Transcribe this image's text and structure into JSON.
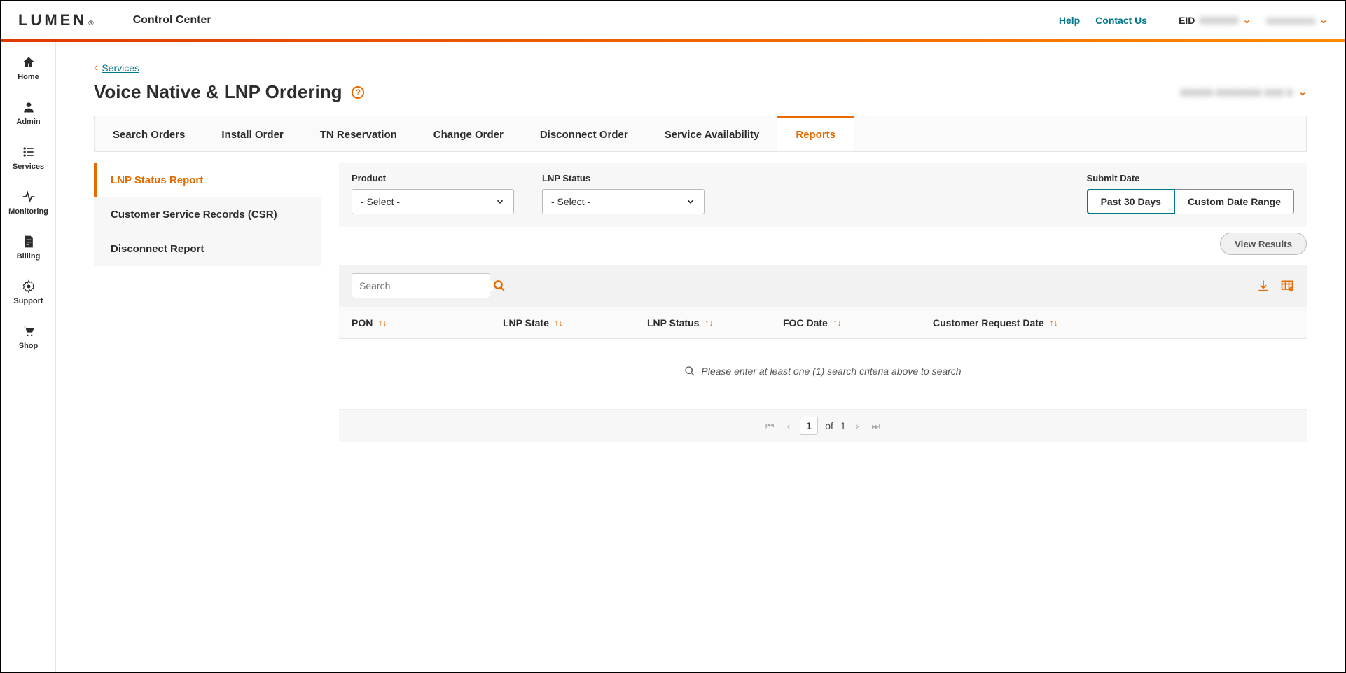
{
  "header": {
    "logo_text": "LUMEN",
    "product_name": "Control Center",
    "help_link": "Help",
    "contact_link": "Contact Us",
    "eid_label": "EID",
    "eid_value": "XXXXXX",
    "account_value": "xxxxxxxxx"
  },
  "left_nav": {
    "items": [
      {
        "label": "Home"
      },
      {
        "label": "Admin"
      },
      {
        "label": "Services"
      },
      {
        "label": "Monitoring"
      },
      {
        "label": "Billing"
      },
      {
        "label": "Support"
      },
      {
        "label": "Shop"
      }
    ]
  },
  "breadcrumb": {
    "link": "Services"
  },
  "page": {
    "title": "Voice Native & LNP Ordering",
    "account_selector": "XXXXX XXXXXXX XXX X"
  },
  "tabs": {
    "items": [
      {
        "label": "Search Orders"
      },
      {
        "label": "Install Order"
      },
      {
        "label": "TN Reservation"
      },
      {
        "label": "Change Order"
      },
      {
        "label": "Disconnect Order"
      },
      {
        "label": "Service Availability"
      },
      {
        "label": "Reports"
      }
    ],
    "active_index": 6
  },
  "sub_nav": {
    "items": [
      {
        "label": "LNP Status Report"
      },
      {
        "label": "Customer Service Records (CSR)"
      },
      {
        "label": "Disconnect Report"
      }
    ],
    "active_index": 0
  },
  "filters": {
    "product": {
      "label": "Product",
      "value": "- Select -"
    },
    "lnp_status": {
      "label": "LNP Status",
      "value": "- Select -"
    },
    "submit_date": {
      "label": "Submit Date",
      "options": [
        "Past 30 Days",
        "Custom Date Range"
      ],
      "active_index": 0
    },
    "view_results_btn": "View Results"
  },
  "results": {
    "search_placeholder": "Search",
    "columns": [
      "PON",
      "LNP State",
      "LNP Status",
      "FOC Date",
      "Customer Request Date"
    ],
    "empty_message": "Please enter at least one (1) search criteria above to search",
    "pager": {
      "current": "1",
      "of_label": "of",
      "total": "1"
    }
  }
}
